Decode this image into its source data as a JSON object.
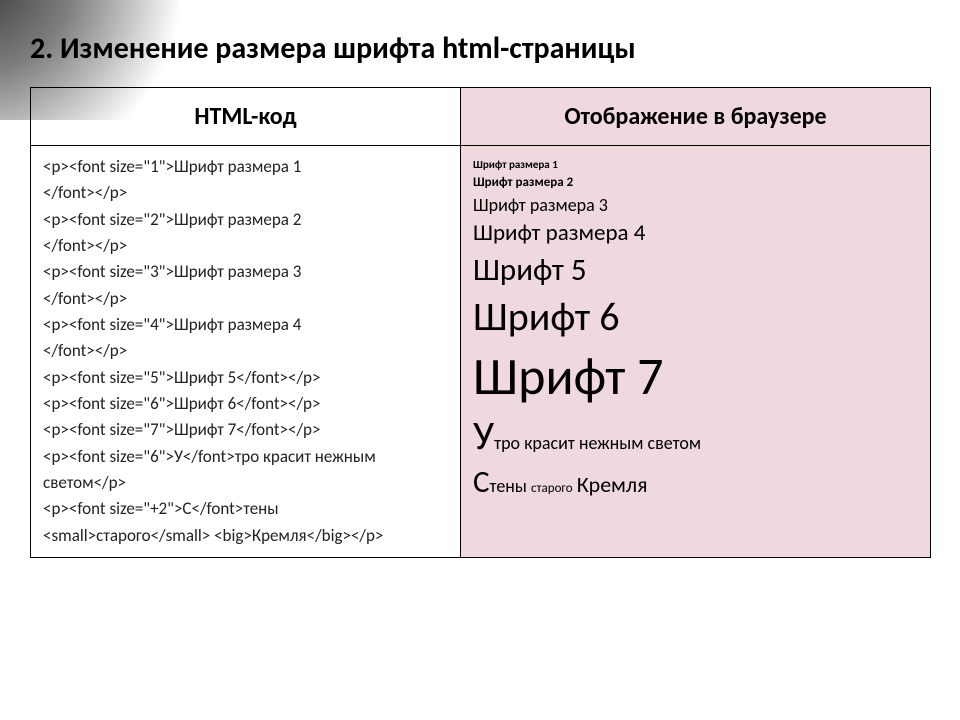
{
  "title": "2. Изменение размера шрифта html-страницы",
  "headers": {
    "code": "HTML-код",
    "browser": "Отображение в браузере"
  },
  "code_lines": [
    "<p><font size=\"1\">Шрифт размера 1",
    "</font></p>",
    "<p><font size=\"2\">Шрифт размера 2",
    "</font></p>",
    "<p><font size=\"3\">Шрифт размера 3",
    "</font></p>",
    "<p><font size=\"4\">Шрифт размера 4",
    "</font></p>",
    "<p><font size=\"5\">Шрифт 5</font></p>",
    "<p><font size=\"6\">Шрифт 6</font></p>",
    "<p><font size=\"7\">Шрифт 7</font></p>",
    "<p><font size=\"6\">У</font>тро красит нежным светом</p>",
    "<p><font size=\"+2\">С</font>тены <small>старого</small> <big>Кремля</big></p>"
  ],
  "browser": {
    "l1": "Шрифт размера 1",
    "l2": "Шрифт размера  2",
    "l3": "Шрифт размера 3",
    "l4": "Шрифт размера 4",
    "l5": "Шрифт 5",
    "l6": "Шрифт 6",
    "l7": "Шрифт 7",
    "line8_cap": "У",
    "line8_rest": "тро красит нежным светом",
    "line9_cap": "С",
    "line9_a": "тены ",
    "line9_small": "старого",
    "line9_space": " ",
    "line9_big": "Кремля"
  }
}
